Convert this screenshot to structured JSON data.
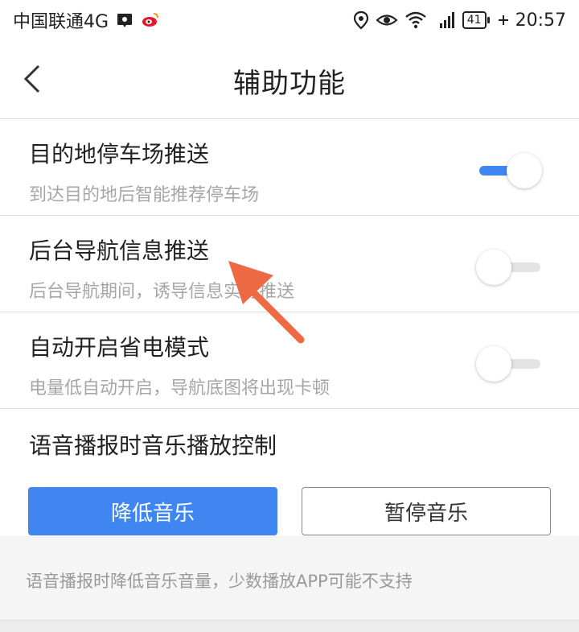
{
  "status_bar": {
    "carrier": "中国联通4G",
    "app_icons": [
      "baidu-paw-icon",
      "weibo-icon"
    ],
    "right_icons": [
      "location-icon",
      "eye-icon",
      "wifi-icon",
      "signal-4g-icon"
    ],
    "battery": "41",
    "time": "20:57"
  },
  "header": {
    "back_icon": "chevron-left-icon",
    "title": "辅助功能"
  },
  "settings": [
    {
      "title": "目的地停车场推送",
      "desc": "到达目的地后智能推荐停车场",
      "enabled": true
    },
    {
      "title": "后台导航信息推送",
      "desc": "后台导航期间，诱导信息实时推送",
      "enabled": false
    },
    {
      "title": "自动开启省电模式",
      "desc": "电量低自动开启，导航底图将出现卡顿",
      "enabled": false
    }
  ],
  "music_control": {
    "title": "语音播报时音乐播放控制",
    "options": [
      "降低音乐",
      "暂停音乐"
    ],
    "selected": "降低音乐",
    "note": "语音播报时降低音乐音量，少数播放APP可能不支持"
  },
  "colors": {
    "accent": "#3f86f0",
    "annotation_arrow": "#ee6a45",
    "desc_text": "#a6a6a6"
  }
}
